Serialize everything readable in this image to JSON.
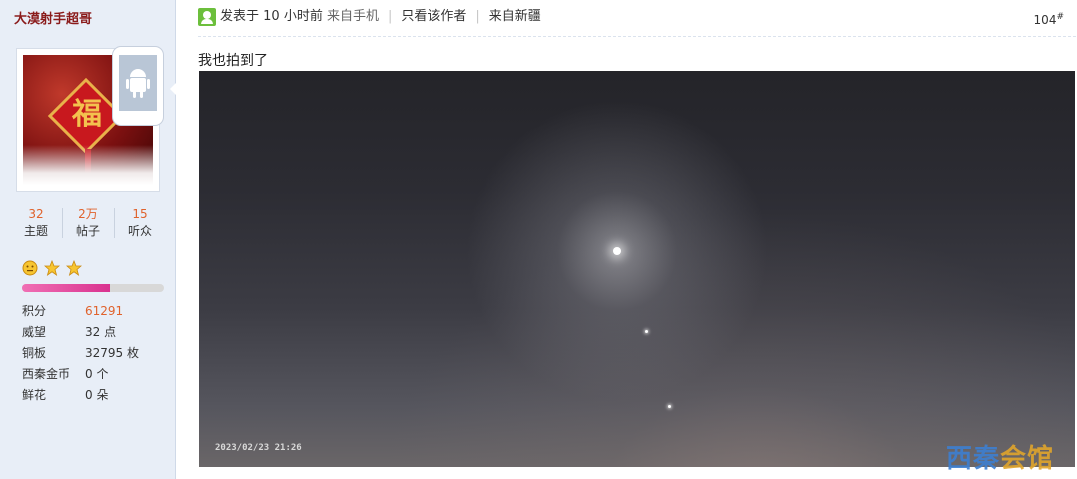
{
  "user": {
    "name": "大漠射手超哥",
    "stats": [
      {
        "value": "32",
        "label": "主题"
      },
      {
        "value": "2万",
        "label": "帖子"
      },
      {
        "value": "15",
        "label": "听众"
      }
    ],
    "rank_icons": [
      "smiley-icon",
      "star-icon",
      "star-icon"
    ],
    "level_progress_fraction": 0.62,
    "profile": [
      {
        "label": "积分",
        "value": "61291",
        "highlight": true
      },
      {
        "label": "威望",
        "value": "32 点"
      },
      {
        "label": "铜板",
        "value": "32795 枚"
      },
      {
        "label": "西秦金币",
        "value": "0 个"
      },
      {
        "label": "鲜花",
        "value": "0 朵"
      }
    ]
  },
  "post": {
    "meta": {
      "posted_prefix": "发表于",
      "time": "10 小时前",
      "source": "来自手机",
      "only_author": "只看该作者",
      "location": "来自新疆"
    },
    "floor": "104",
    "floor_suffix": "#",
    "text": "我也拍到了",
    "photo_timestamp": "2023/02/23 21:26"
  },
  "watermark": {
    "part1": "西秦",
    "part2": "会馆"
  },
  "colors": {
    "username": "#8a1b1b",
    "accent_orange": "#e0622c",
    "sidebar_bg": "#e8eef7",
    "level_bar": "#d9328f",
    "watermark_blue": "#3d7fd1",
    "watermark_orange": "#e0a52c"
  }
}
